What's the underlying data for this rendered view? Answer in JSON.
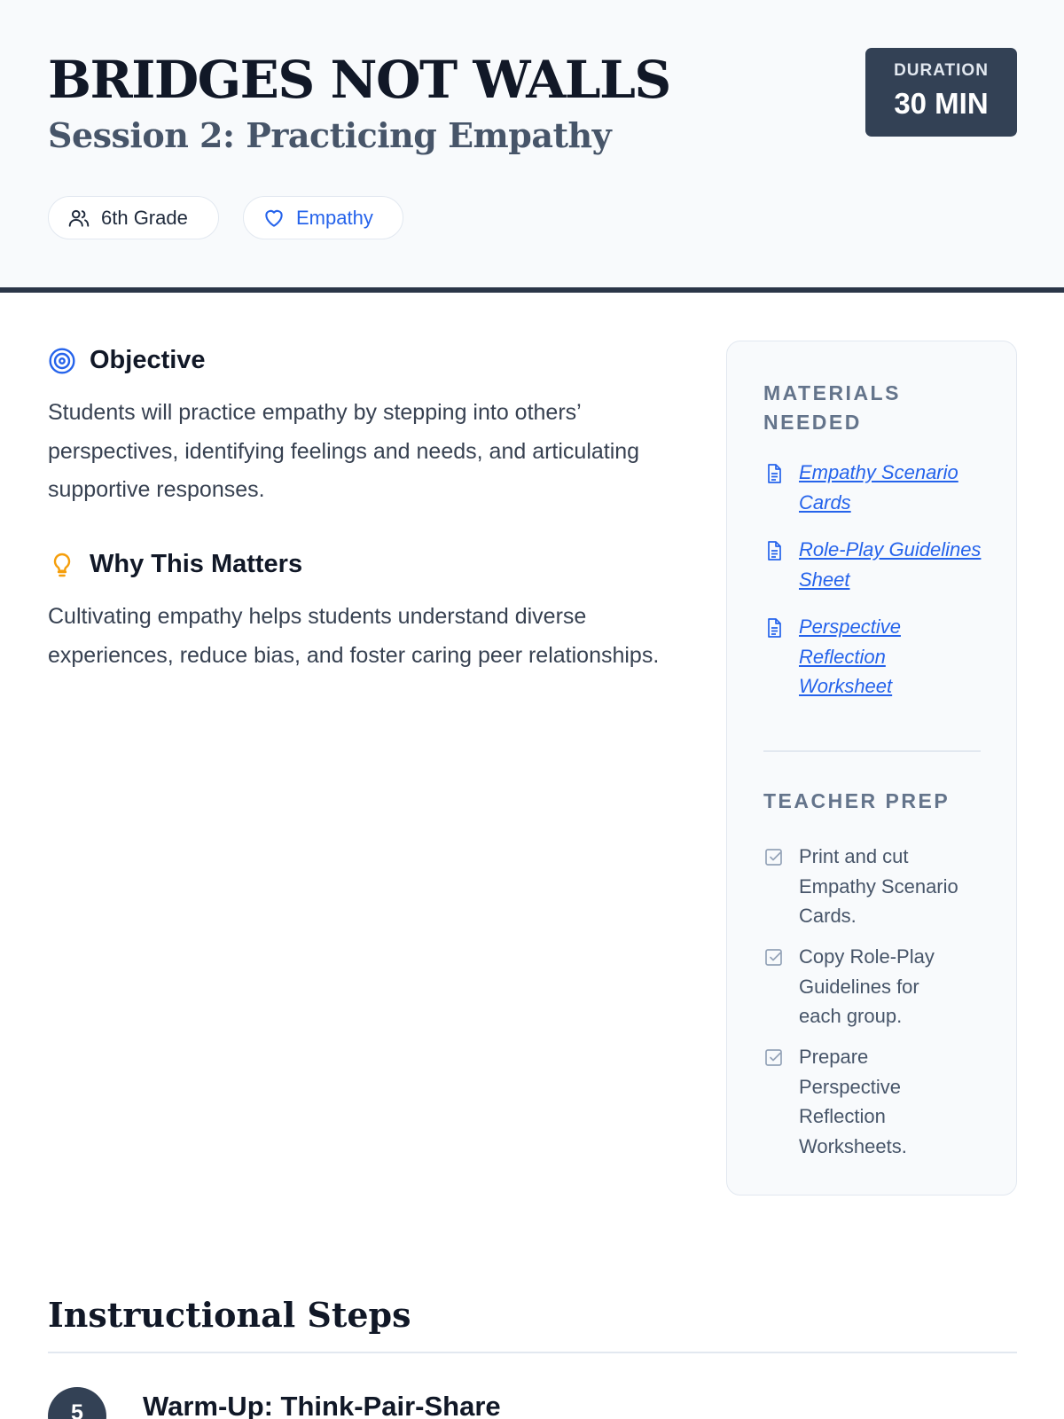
{
  "header": {
    "title": "BRIDGES NOT WALLS",
    "subtitle": "Session 2: Practicing Empathy",
    "duration_label": "DURATION",
    "duration_value": "30 MIN",
    "grade": "6th Grade",
    "tag": "Empathy"
  },
  "objective": {
    "heading": "Objective",
    "body": "Students will practice empathy by stepping into others’ perspectives, identifying feelings and needs, and articulating supportive responses."
  },
  "why": {
    "heading": "Why This Matters",
    "body": "Cultivating empathy helps students understand diverse experiences, reduce bias, and foster caring peer relationships."
  },
  "materials": {
    "heading": "MATERIALS NEEDED",
    "items": [
      "Empathy Scenario Cards",
      "Role-Play Guidelines Sheet",
      "Perspective Reflection Worksheet"
    ]
  },
  "prep": {
    "heading": "TEACHER PREP",
    "items": [
      "Print and cut Empathy Scenario Cards.",
      "Copy Role-Play Guidelines for each group.",
      "Prepare Perspective Reflection Worksheets."
    ]
  },
  "steps": {
    "heading": "Instructional Steps",
    "items": [
      {
        "number": "5",
        "title": "Warm-Up: Think-Pair-Share"
      }
    ]
  },
  "colors": {
    "accent": "#2563eb",
    "dark": "#334155",
    "bulb": "#f59e0b"
  },
  "icons": {
    "grade": "users-icon",
    "tag": "heart-icon",
    "objective": "target-icon",
    "why": "lightbulb-icon",
    "material": "document-icon",
    "prep": "checkbox-icon"
  }
}
